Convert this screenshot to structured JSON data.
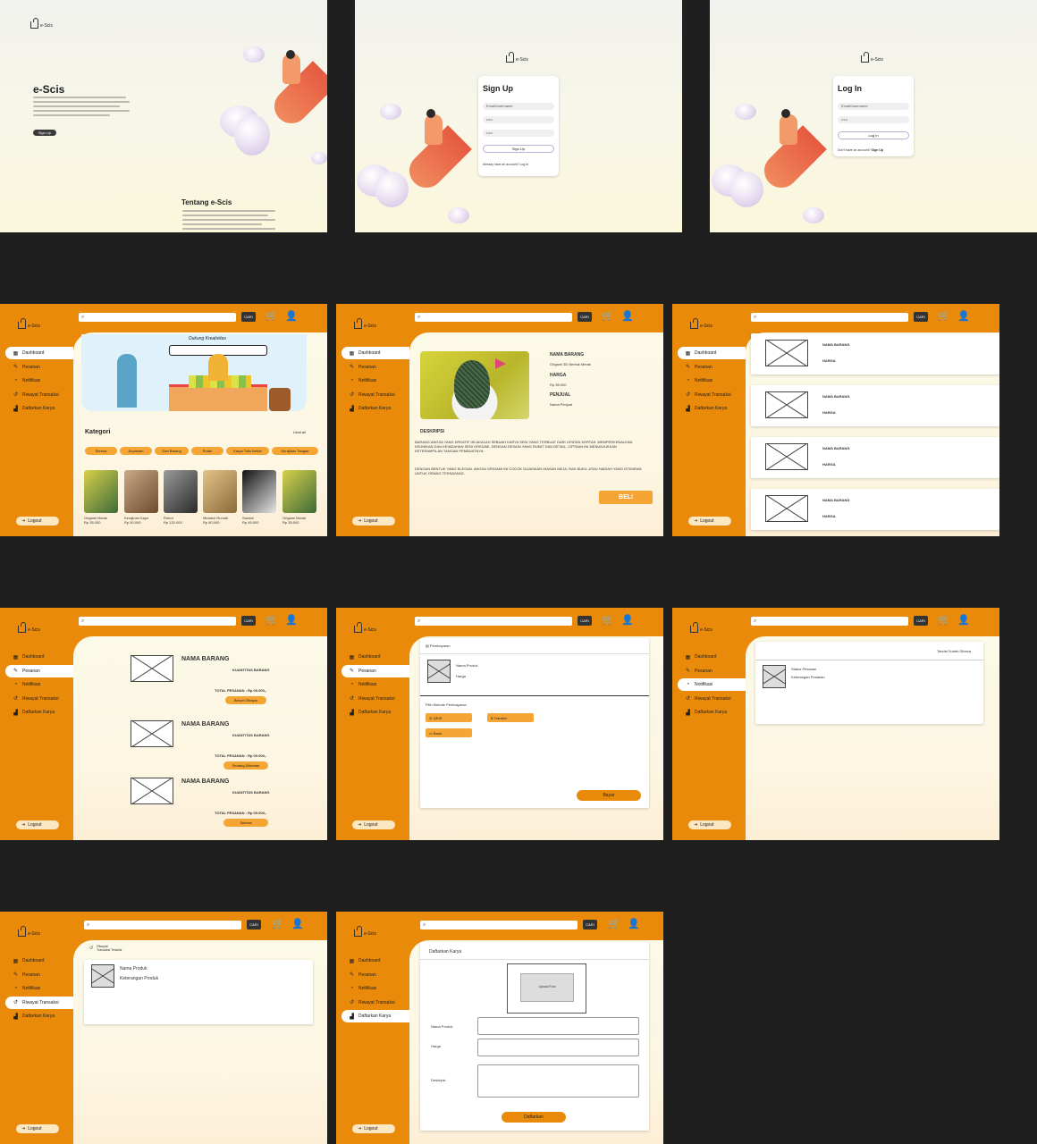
{
  "brand": {
    "logo_text": "e-Scis"
  },
  "landing": {
    "title": "e-Scis",
    "cta": "Sign Up",
    "about_title": "Tentang e-Scis"
  },
  "signup": {
    "title": "Sign Up",
    "field1": "Email/Username",
    "field2": "•••••",
    "field3": "•••••",
    "button": "Sign Up",
    "footer": "Already have an account? Log In"
  },
  "login": {
    "title": "Log In",
    "field1": "Email/Username",
    "field2": "•••••",
    "button": "Log In",
    "footer": "Don't have an account?",
    "footer_link": "Sign Up"
  },
  "common": {
    "search_button": "CARI",
    "logout": "Logout",
    "cart_icon": "cart-icon",
    "user_icon": "user-icon"
  },
  "menu": {
    "items": [
      "Dashboard",
      "Pesanan",
      "Notifikasi",
      "Riwayat Transaksi",
      "Daftarkan Karya"
    ]
  },
  "dashboard": {
    "banner_caption": "Dukung Kreativitas",
    "kategori_title": "Kategori",
    "see_all": "Lihat all",
    "categories": [
      "Semua",
      "Anyaman",
      "Dari Barang",
      "Rotan",
      "Karya Tulis Ilmiah",
      "Kerajinan Tangan"
    ],
    "products": [
      {
        "name": "Origami Merak",
        "price": "Rp 35.000"
      },
      {
        "name": "Kerajinan Kayu",
        "price": "Rp 50.000"
      },
      {
        "name": "Robot",
        "price": "Rp 120.000"
      },
      {
        "name": "Miniatur Rumah",
        "price": "Rp 80.000"
      },
      {
        "name": "Sandal",
        "price": "Rp 45.000"
      },
      {
        "name": "Origami Merak",
        "price": "Rp 35.000"
      }
    ]
  },
  "detail": {
    "name_label": "NAMA BARANG",
    "name_value": "Origami 3D Bentuk Merak",
    "harga_label": "HARGA",
    "harga_value": "Rp 35.000",
    "penjual_label": "PENJUAL",
    "penjual_value": "Nama Penjual",
    "deskripsi_label": "DESKRIPSI",
    "deskripsi_1": "BARANG ANGSA YANG KREATIF INI ADALAH SEBUAH KARYA SENI YANG TERBUAT DARI LIPATAN KERTAS. MEMPERKENALKAN KEUNIKAN DAN KEINDAHAN SENI ORIGAMI, DENGAN DESAIN YANG RUMIT DAN DETAIL, CIPTAAN INI MENUNJUKKAN KETERAMPILAN TANGAN PEMBUATNYA.",
    "deskripsi_2": "DENGAN BENTUK YANG ELEGAN, ANGSA ORIGAMI INI COCOK DIJADIKAN HIASAN MEJA, RAK BUKU, ATAU HADIAH YANG ISTIMEWA UNTUK ORANG TERSAYANG.",
    "buy": "BELI"
  },
  "list": {
    "item_name": "NAMA BARANG",
    "item_price": "HARGA"
  },
  "pesanan": {
    "item_name": "NAMA BARANG",
    "kuantitas": "KUANTITAS BARANG",
    "total": "TOTAL PESANAN : Rp 00.000,-",
    "statuses": [
      "Belum Dibayar",
      "Sedang Dikemas",
      "Selesai"
    ]
  },
  "checkout": {
    "title": "Pembayaran",
    "product": "Nama Produk",
    "price": "Harga",
    "method_title": "Pilih Metode Pembayaran",
    "methods": [
      "QRIS",
      "Transfer",
      "Bank"
    ],
    "pay": "Bayar"
  },
  "notif": {
    "mark_read": "Tandai Sudah Dibaca",
    "status": "Status Pesanan",
    "desc": "Keterangan Pesanan"
  },
  "riwayat": {
    "title": "Riwayat",
    "subtitle": "Transaksi Terakhir",
    "product": "Nama Produk",
    "desc": "Keterangan Produk"
  },
  "daftar": {
    "title": "Daftarkan Karya",
    "upload": "Upload Foto",
    "f1": "Nama Produk",
    "f2": "Harga",
    "f3": "Deskripsi",
    "submit": "Daftarkan"
  },
  "colors": {
    "primary": "#e98a0b",
    "accent": "#f5a534",
    "bg": "#1f1f1f"
  }
}
